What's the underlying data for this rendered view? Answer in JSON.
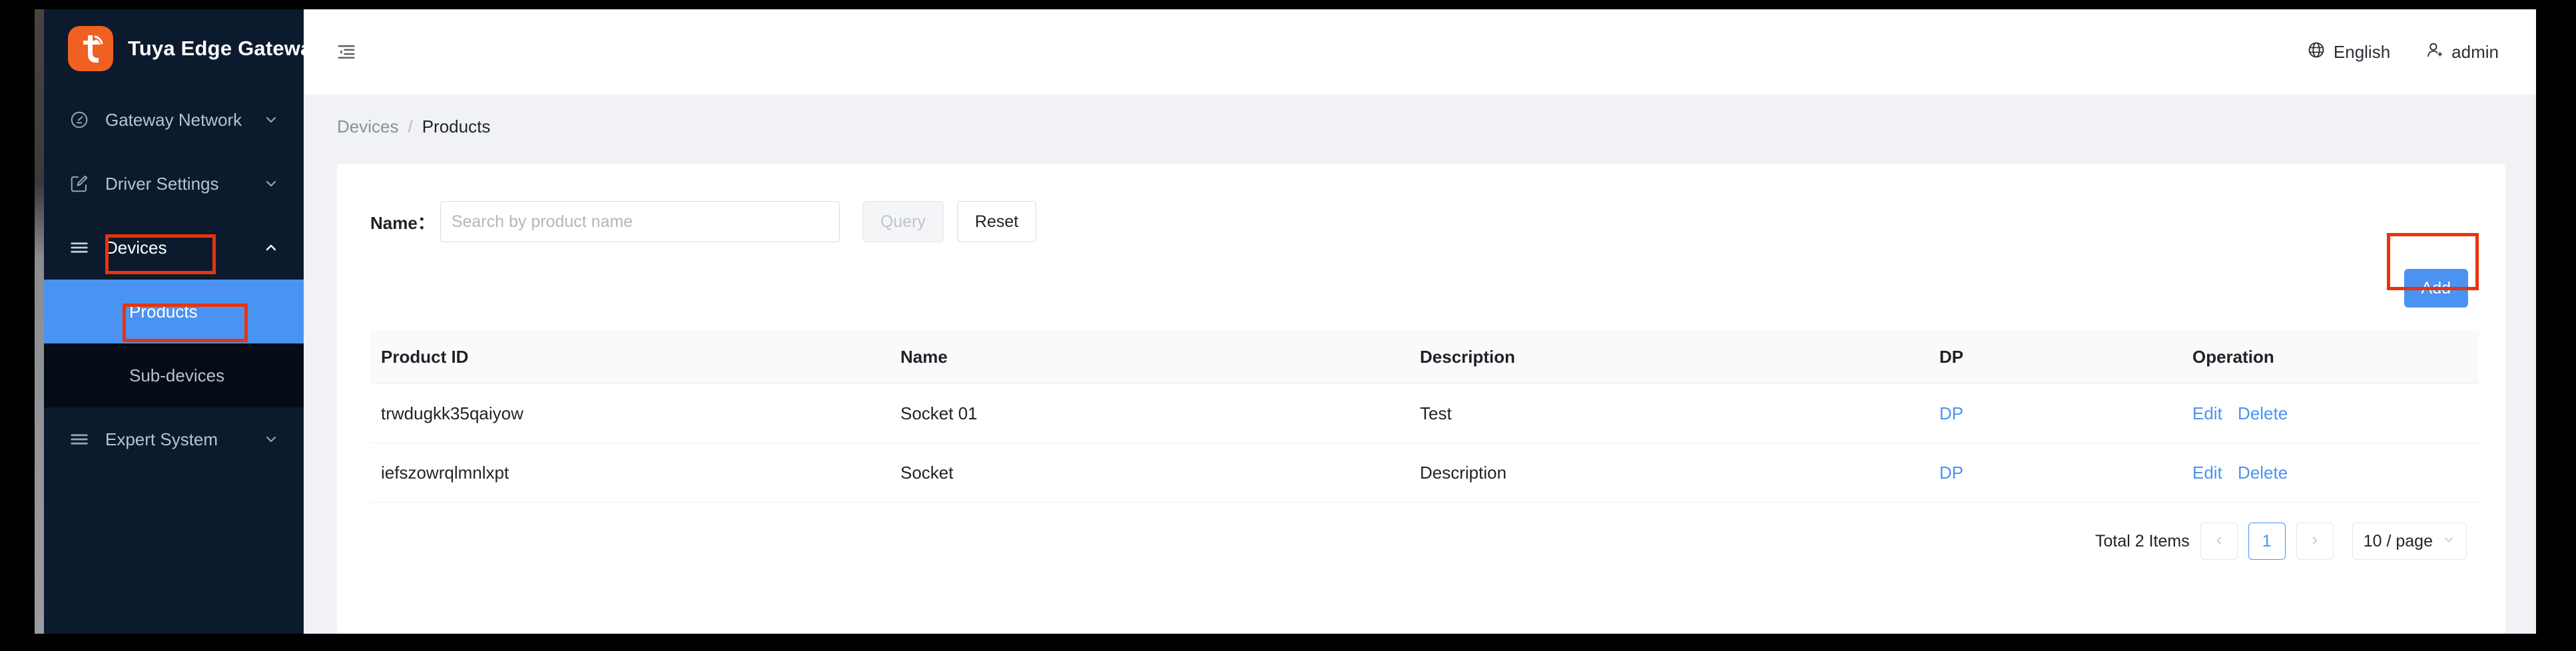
{
  "app": {
    "title": "Tuya Edge Gateway",
    "logo_icon": "tuya-logo-icon",
    "brand_color": "#f06022",
    "sidebar_bg": "#0c1a2e",
    "accent_color": "#4a93f2",
    "highlight_color": "#e8340c"
  },
  "sidebar": {
    "items": [
      {
        "label": "Gateway Network",
        "icon": "dashboard-gauge-icon",
        "arrow": "chevron-down-icon",
        "expanded": false
      },
      {
        "label": "Driver Settings",
        "icon": "form-edit-icon",
        "arrow": "chevron-down-icon",
        "expanded": false
      },
      {
        "label": "Devices",
        "icon": "menu-lines-icon",
        "arrow": "chevron-up-icon",
        "expanded": true
      },
      {
        "label": "Expert System",
        "icon": "menu-lines-icon",
        "arrow": "chevron-down-icon",
        "expanded": false
      }
    ],
    "submenu": [
      {
        "label": "Products",
        "selected": true
      },
      {
        "label": "Sub-devices",
        "selected": false
      }
    ]
  },
  "topbar": {
    "fold_icon": "menu-fold-icon",
    "language_icon": "globe-icon",
    "language": "English",
    "user_icon": "user-add-icon",
    "user": "admin"
  },
  "breadcrumb": {
    "parent": "Devices",
    "separator": "/",
    "current": "Products"
  },
  "filter": {
    "name_label": "Name：",
    "name_value": "",
    "name_placeholder": "Search by product name",
    "query_label": "Query",
    "query_disabled": true,
    "reset_label": "Reset"
  },
  "toolbar": {
    "add_label": "Add"
  },
  "table": {
    "columns": [
      "Product ID",
      "Name",
      "Description",
      "DP",
      "Operation"
    ],
    "rows": [
      {
        "product_id": "trwdugkk35qaiyow",
        "name": "Socket 01",
        "description": "Test",
        "dp": "DP",
        "edit": "Edit",
        "delete": "Delete"
      },
      {
        "product_id": "iefszowrqlmnlxpt",
        "name": "Socket",
        "description": "Description",
        "dp": "DP",
        "edit": "Edit",
        "delete": "Delete"
      }
    ]
  },
  "pagination": {
    "total_text": "Total 2 Items",
    "prev_icon": "chevron-left-icon",
    "next_icon": "chevron-right-icon",
    "current_page": "1",
    "page_size": "10 / page",
    "page_size_icon": "chevron-down-icon"
  }
}
